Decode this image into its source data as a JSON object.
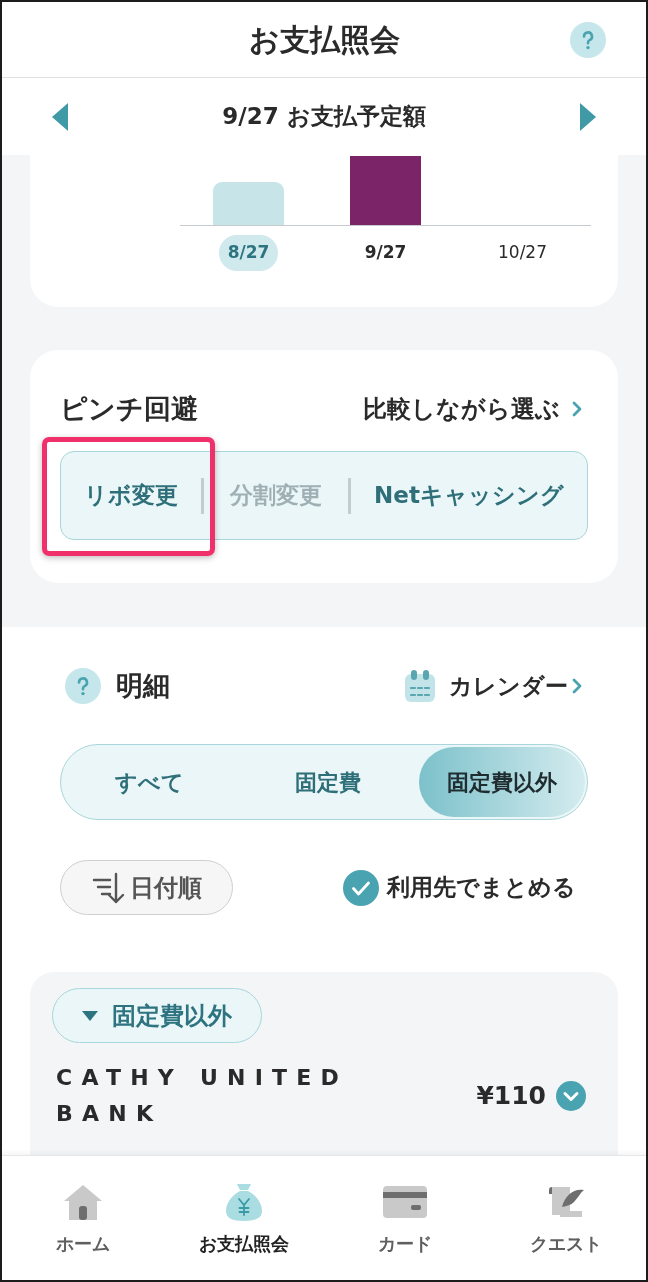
{
  "header": {
    "title": "お支払照会"
  },
  "period_nav": {
    "title": "9/27 お支払予定額"
  },
  "payment_chart": {
    "months": [
      {
        "label": "8/27",
        "kind": "past"
      },
      {
        "label": "9/27",
        "kind": "current"
      },
      {
        "label": "10/27",
        "kind": "future"
      }
    ]
  },
  "pinch_avoid": {
    "title": "ピンチ回避",
    "link": "比較しながら選ぶ",
    "options": [
      {
        "label": "リボ変更",
        "disabled": false,
        "annotated": true
      },
      {
        "label": "分割変更",
        "disabled": true,
        "annotated": false
      },
      {
        "label": "Netキャッシング",
        "disabled": false,
        "annotated": false
      }
    ]
  },
  "details": {
    "title": "明細",
    "calendar_link": "カレンダー",
    "filter_tabs": [
      {
        "label": "すべて",
        "selected": false
      },
      {
        "label": "固定費",
        "selected": false
      },
      {
        "label": "固定費以外",
        "selected": true
      }
    ],
    "sort_button": "日付順",
    "group_by_merchant": {
      "label": "利用先でまとめる",
      "checked": true
    },
    "group": {
      "label": "固定費以外",
      "expanded": true,
      "items": [
        {
          "merchant": "CATHY UNITED BANK",
          "amount": "¥110"
        }
      ]
    }
  },
  "bottom_nav": [
    {
      "label": "ホーム",
      "kind": "home",
      "selected": false
    },
    {
      "label": "お支払照会",
      "kind": "payment",
      "selected": true
    },
    {
      "label": "カード",
      "kind": "card",
      "selected": false
    },
    {
      "label": "クエスト",
      "kind": "quest",
      "selected": false
    }
  ]
}
